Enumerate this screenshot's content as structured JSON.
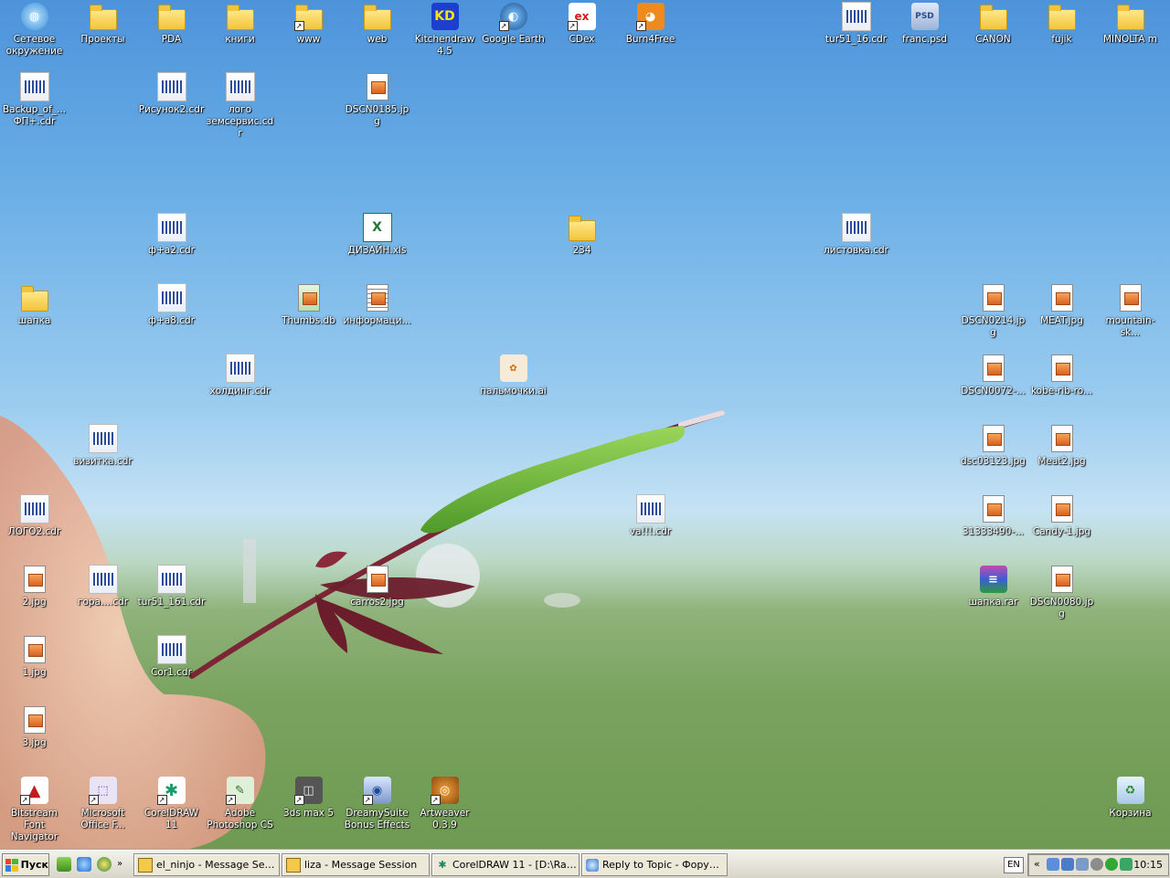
{
  "desktop": {
    "icons": [
      {
        "label": "Сетевое окружение",
        "type": "network",
        "shortcut": false
      },
      {
        "label": "Проекты",
        "type": "folder",
        "shortcut": false
      },
      {
        "label": "PDA",
        "type": "folder",
        "shortcut": false
      },
      {
        "label": "книги",
        "type": "folder",
        "shortcut": false
      },
      {
        "label": "www",
        "type": "folder",
        "shortcut": true
      },
      {
        "label": "web",
        "type": "folder",
        "shortcut": false
      },
      {
        "label": "Kitchendraw 4.5",
        "type": "app-kd",
        "shortcut": false
      },
      {
        "label": "Google Earth",
        "type": "app-earth",
        "shortcut": true
      },
      {
        "label": "CDex",
        "type": "app-cdex",
        "shortcut": true
      },
      {
        "label": "Burn4Free",
        "type": "app-burn",
        "shortcut": true
      },
      {
        "label": "tur51_16.cdr",
        "type": "cdr",
        "shortcut": false
      },
      {
        "label": "franc.psd",
        "type": "psd",
        "shortcut": false
      },
      {
        "label": "CANON",
        "type": "folder",
        "shortcut": false
      },
      {
        "label": "fujik",
        "type": "folder",
        "shortcut": false
      },
      {
        "label": "MINOLTA m",
        "type": "folder",
        "shortcut": false
      },
      {
        "label": "Backup_of_... ФП+.cdr",
        "type": "cdr",
        "shortcut": false
      },
      {
        "label": "Рисунок2.cdr",
        "type": "cdr",
        "shortcut": false
      },
      {
        "label": "лого земсервис.cdr",
        "type": "cdr",
        "shortcut": false
      },
      {
        "label": "DSCN0185.jpg",
        "type": "jpg",
        "shortcut": false
      },
      {
        "label": "ф+а2.cdr",
        "type": "cdr",
        "shortcut": false
      },
      {
        "label": "ДИЗАЙН.xls",
        "type": "xls",
        "shortcut": false
      },
      {
        "label": "234",
        "type": "folder",
        "shortcut": false
      },
      {
        "label": "листовка.cdr",
        "type": "cdr",
        "shortcut": false
      },
      {
        "label": "шапка",
        "type": "folder",
        "shortcut": false
      },
      {
        "label": "ф+а8.cdr",
        "type": "cdr",
        "shortcut": false
      },
      {
        "label": "Thumbs.db",
        "type": "db",
        "shortcut": false
      },
      {
        "label": "информаци...",
        "type": "txt",
        "shortcut": false
      },
      {
        "label": "DSCN0214.jpg",
        "type": "jpg",
        "shortcut": false
      },
      {
        "label": "MEAT.jpg",
        "type": "jpg",
        "shortcut": false
      },
      {
        "label": "mountain-sk...",
        "type": "jpg",
        "shortcut": false
      },
      {
        "label": "холдинг.cdr",
        "type": "cdr",
        "shortcut": false
      },
      {
        "label": "пальмочки.ai",
        "type": "ai",
        "shortcut": false
      },
      {
        "label": "DSCN0072-...",
        "type": "jpg",
        "shortcut": false
      },
      {
        "label": "kobe-rib-ro...",
        "type": "jpg",
        "shortcut": false
      },
      {
        "label": "визитка.cdr",
        "type": "cdr",
        "shortcut": false
      },
      {
        "label": "dsc03123.jpg",
        "type": "jpg",
        "shortcut": false
      },
      {
        "label": "Meat2.jpg",
        "type": "jpg",
        "shortcut": false
      },
      {
        "label": "ЛОГО2.cdr",
        "type": "cdr",
        "shortcut": false
      },
      {
        "label": "va!!!.cdr",
        "type": "cdr",
        "shortcut": false
      },
      {
        "label": "31333490-...",
        "type": "jpg",
        "shortcut": false
      },
      {
        "label": "Candy-1.jpg",
        "type": "jpg",
        "shortcut": false
      },
      {
        "label": "2.jpg",
        "type": "jpg",
        "shortcut": false
      },
      {
        "label": "гора....cdr",
        "type": "cdr",
        "shortcut": false
      },
      {
        "label": "tur51_161.cdr",
        "type": "cdr",
        "shortcut": false
      },
      {
        "label": "carros2.jpg",
        "type": "jpg",
        "shortcut": false
      },
      {
        "label": "шапка.rar",
        "type": "rar",
        "shortcut": false
      },
      {
        "label": "DSCN0080.jpg",
        "type": "jpg",
        "shortcut": false
      },
      {
        "label": "1.jpg",
        "type": "jpg",
        "shortcut": false
      },
      {
        "label": "Cor1.cdr",
        "type": "cdr",
        "shortcut": false
      },
      {
        "label": "3.jpg",
        "type": "jpg",
        "shortcut": false
      },
      {
        "label": "Bitstream Font Navigator",
        "type": "app-font",
        "shortcut": true
      },
      {
        "label": "Microsoft Office F...",
        "type": "app-office",
        "shortcut": true
      },
      {
        "label": "CorelDRAW 11",
        "type": "app-corel",
        "shortcut": true
      },
      {
        "label": "Adobe Photoshop CS",
        "type": "app-ps",
        "shortcut": true
      },
      {
        "label": "3ds max 5",
        "type": "app-3ds",
        "shortcut": true
      },
      {
        "label": "DreamySuite Bonus Effects",
        "type": "app-dream",
        "shortcut": true
      },
      {
        "label": "Artweaver 0.3.9",
        "type": "app-art",
        "shortcut": true
      },
      {
        "label": "Корзина",
        "type": "recycle",
        "shortcut": false
      }
    ]
  },
  "taskbar": {
    "start_label": "Пуск",
    "tasks": [
      {
        "label": "el_ninjo - Message Session"
      },
      {
        "label": "liza - Message Session"
      },
      {
        "label": "CorelDRAW 11 - [D:\\Rab..."
      },
      {
        "label": "Reply to Topic - Форум ..."
      }
    ],
    "language": "EN",
    "tray_chevron": "«",
    "clock": "10:15"
  },
  "colors": {
    "taskbar": "#ece9d8",
    "sky": "#6aaee6",
    "grass": "#7aa35f"
  }
}
